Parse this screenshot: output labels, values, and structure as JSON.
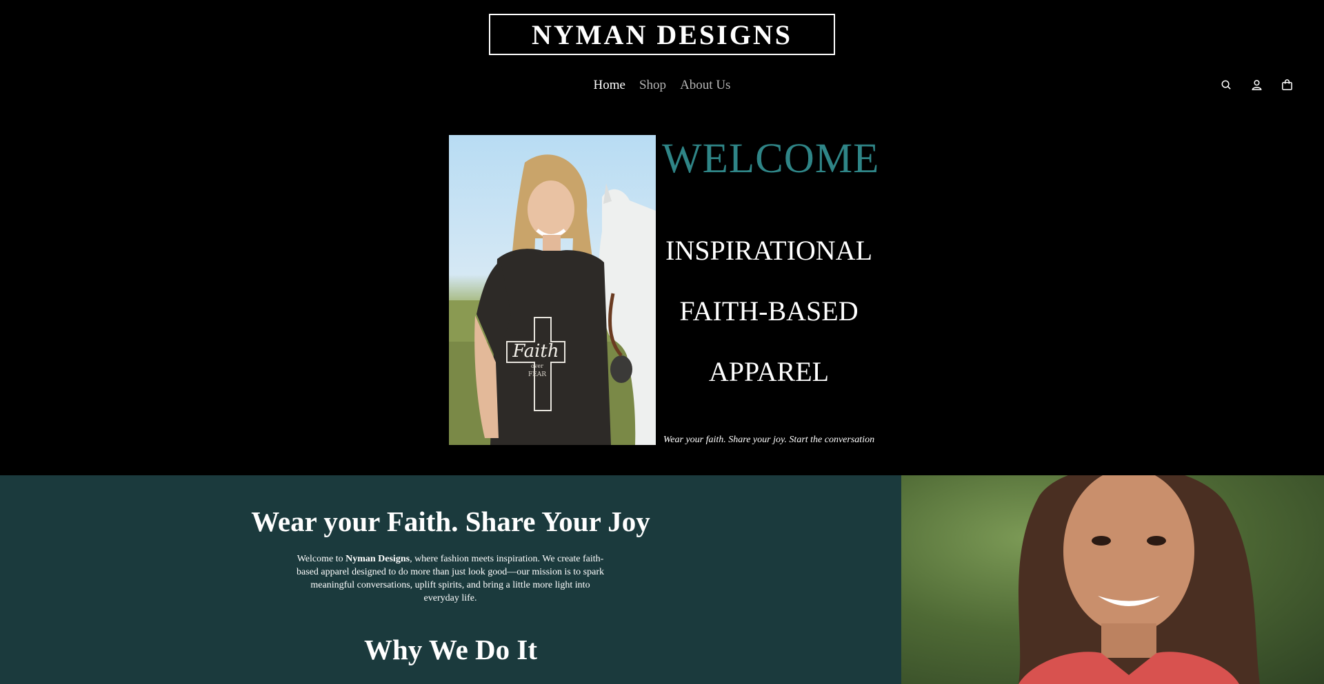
{
  "header": {
    "logo": "NYMAN DESIGNS",
    "nav": [
      {
        "label": "Home",
        "active": true
      },
      {
        "label": "Shop",
        "active": false
      },
      {
        "label": "About Us",
        "active": false
      }
    ],
    "icons": [
      "search-icon",
      "account-icon",
      "cart-icon"
    ]
  },
  "hero": {
    "welcome": "WELCOME",
    "line1": "INSPIRATIONAL",
    "line2": "FAITH-BASED",
    "line3": "APPAREL",
    "tagline": "Wear your faith. Share your joy. Start the conversation",
    "shirt_text_main": "Faith",
    "shirt_text_over": "over",
    "shirt_text_fear": "FEAR"
  },
  "about": {
    "title": "Wear your Faith. Share Your Joy",
    "intro_prefix": "Welcome to ",
    "brand": "Nyman Designs",
    "intro_rest": ", where fashion meets inspiration. We create faith-based apparel designed to do more than just look good—our mission is to spark meaningful conversations, uplift spirits, and bring a little more light into everyday life.",
    "why_title": "Why We Do It"
  },
  "colors": {
    "accent": "#2f8587",
    "section_bg": "#1b3a3d",
    "page_bg": "#000000"
  }
}
